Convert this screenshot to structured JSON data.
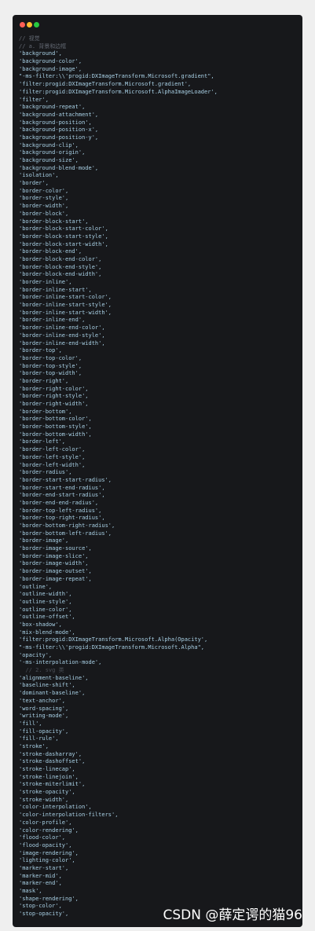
{
  "window": {
    "traffic_lights": [
      "close",
      "minimize",
      "maximize"
    ],
    "colors": {
      "background": "#17181b",
      "string": "#a9d1e6",
      "comment": "#636973"
    }
  },
  "code_lines": [
    {
      "text": "// 视觉",
      "type": "comment"
    },
    {
      "text": "// a. 背景和边框",
      "type": "comment"
    },
    {
      "text": "'background',",
      "type": "string"
    },
    {
      "text": "'background-color',",
      "type": "string"
    },
    {
      "text": "'background-image',",
      "type": "string"
    },
    {
      "text": "\"-ms-filter:\\\\'progid:DXImageTransform.Microsoft.gradient\",",
      "type": "string"
    },
    {
      "text": "'filter:progid:DXImageTransform.Microsoft.gradient',",
      "type": "string"
    },
    {
      "text": "'filter:progid:DXImageTransform.Microsoft.AlphaImageLoader',",
      "type": "string"
    },
    {
      "text": "'filter',",
      "type": "string"
    },
    {
      "text": "'background-repeat',",
      "type": "string"
    },
    {
      "text": "'background-attachment',",
      "type": "string"
    },
    {
      "text": "'background-position',",
      "type": "string"
    },
    {
      "text": "'background-position-x',",
      "type": "string"
    },
    {
      "text": "'background-position-y',",
      "type": "string"
    },
    {
      "text": "'background-clip',",
      "type": "string"
    },
    {
      "text": "'background-origin',",
      "type": "string"
    },
    {
      "text": "'background-size',",
      "type": "string"
    },
    {
      "text": "'background-blend-mode',",
      "type": "string"
    },
    {
      "text": "'isolation',",
      "type": "string"
    },
    {
      "text": "'border',",
      "type": "string"
    },
    {
      "text": "'border-color',",
      "type": "string"
    },
    {
      "text": "'border-style',",
      "type": "string"
    },
    {
      "text": "'border-width',",
      "type": "string"
    },
    {
      "text": "'border-block',",
      "type": "string"
    },
    {
      "text": "'border-block-start',",
      "type": "string"
    },
    {
      "text": "'border-block-start-color',",
      "type": "string"
    },
    {
      "text": "'border-block-start-style',",
      "type": "string"
    },
    {
      "text": "'border-block-start-width',",
      "type": "string"
    },
    {
      "text": "'border-block-end',",
      "type": "string"
    },
    {
      "text": "'border-block-end-color',",
      "type": "string"
    },
    {
      "text": "'border-block-end-style',",
      "type": "string"
    },
    {
      "text": "'border-block-end-width',",
      "type": "string"
    },
    {
      "text": "'border-inline',",
      "type": "string"
    },
    {
      "text": "'border-inline-start',",
      "type": "string"
    },
    {
      "text": "'border-inline-start-color',",
      "type": "string"
    },
    {
      "text": "'border-inline-start-style',",
      "type": "string"
    },
    {
      "text": "'border-inline-start-width',",
      "type": "string"
    },
    {
      "text": "'border-inline-end',",
      "type": "string"
    },
    {
      "text": "'border-inline-end-color',",
      "type": "string"
    },
    {
      "text": "'border-inline-end-style',",
      "type": "string"
    },
    {
      "text": "'border-inline-end-width',",
      "type": "string"
    },
    {
      "text": "'border-top',",
      "type": "string"
    },
    {
      "text": "'border-top-color',",
      "type": "string"
    },
    {
      "text": "'border-top-style',",
      "type": "string"
    },
    {
      "text": "'border-top-width',",
      "type": "string"
    },
    {
      "text": "'border-right',",
      "type": "string"
    },
    {
      "text": "'border-right-color',",
      "type": "string"
    },
    {
      "text": "'border-right-style',",
      "type": "string"
    },
    {
      "text": "'border-right-width',",
      "type": "string"
    },
    {
      "text": "'border-bottom',",
      "type": "string"
    },
    {
      "text": "'border-bottom-color',",
      "type": "string"
    },
    {
      "text": "'border-bottom-style',",
      "type": "string"
    },
    {
      "text": "'border-bottom-width',",
      "type": "string"
    },
    {
      "text": "'border-left',",
      "type": "string"
    },
    {
      "text": "'border-left-color',",
      "type": "string"
    },
    {
      "text": "'border-left-style',",
      "type": "string"
    },
    {
      "text": "'border-left-width',",
      "type": "string"
    },
    {
      "text": "'border-radius',",
      "type": "string"
    },
    {
      "text": "'border-start-start-radius',",
      "type": "string"
    },
    {
      "text": "'border-start-end-radius',",
      "type": "string"
    },
    {
      "text": "'border-end-start-radius',",
      "type": "string"
    },
    {
      "text": "'border-end-end-radius',",
      "type": "string"
    },
    {
      "text": "'border-top-left-radius',",
      "type": "string"
    },
    {
      "text": "'border-top-right-radius',",
      "type": "string"
    },
    {
      "text": "'border-bottom-right-radius',",
      "type": "string"
    },
    {
      "text": "'border-bottom-left-radius',",
      "type": "string"
    },
    {
      "text": "'border-image',",
      "type": "string"
    },
    {
      "text": "'border-image-source',",
      "type": "string"
    },
    {
      "text": "'border-image-slice',",
      "type": "string"
    },
    {
      "text": "'border-image-width',",
      "type": "string"
    },
    {
      "text": "'border-image-outset',",
      "type": "string"
    },
    {
      "text": "'border-image-repeat',",
      "type": "string"
    },
    {
      "text": "'outline',",
      "type": "string"
    },
    {
      "text": "'outline-width',",
      "type": "string"
    },
    {
      "text": "'outline-style',",
      "type": "string"
    },
    {
      "text": "'outline-color',",
      "type": "string"
    },
    {
      "text": "'outline-offset',",
      "type": "string"
    },
    {
      "text": "'box-shadow',",
      "type": "string"
    },
    {
      "text": "'mix-blend-mode',",
      "type": "string"
    },
    {
      "text": "'filter:progid:DXImageTransform.Microsoft.Alpha(Opacity',",
      "type": "string"
    },
    {
      "text": "\"-ms-filter:\\\\'progid:DXImageTransform.Microsoft.Alpha\",",
      "type": "string"
    },
    {
      "text": "'opacity',",
      "type": "string"
    },
    {
      "text": "'-ms-interpolation-mode',",
      "type": "string"
    },
    {
      "text": "  // 2. svg 类",
      "type": "comment-dim"
    },
    {
      "text": "'alignment-baseline',",
      "type": "string"
    },
    {
      "text": "'baseline-shift',",
      "type": "string"
    },
    {
      "text": "'dominant-baseline',",
      "type": "string"
    },
    {
      "text": "'text-anchor',",
      "type": "string"
    },
    {
      "text": "'word-spacing',",
      "type": "string"
    },
    {
      "text": "'writing-mode',",
      "type": "string"
    },
    {
      "text": "'fill',",
      "type": "string"
    },
    {
      "text": "'fill-opacity',",
      "type": "string"
    },
    {
      "text": "'fill-rule',",
      "type": "string"
    },
    {
      "text": "'stroke',",
      "type": "string"
    },
    {
      "text": "'stroke-dasharray',",
      "type": "string"
    },
    {
      "text": "'stroke-dashoffset',",
      "type": "string"
    },
    {
      "text": "'stroke-linecap',",
      "type": "string"
    },
    {
      "text": "'stroke-linejoin',",
      "type": "string"
    },
    {
      "text": "'stroke-miterlimit',",
      "type": "string"
    },
    {
      "text": "'stroke-opacity',",
      "type": "string"
    },
    {
      "text": "'stroke-width',",
      "type": "string"
    },
    {
      "text": "'color-interpolation',",
      "type": "string"
    },
    {
      "text": "'color-interpolation-filters',",
      "type": "string"
    },
    {
      "text": "'color-profile',",
      "type": "string"
    },
    {
      "text": "'color-rendering',",
      "type": "string"
    },
    {
      "text": "'flood-color',",
      "type": "string"
    },
    {
      "text": "'flood-opacity',",
      "type": "string"
    },
    {
      "text": "'image-rendering',",
      "type": "string"
    },
    {
      "text": "'lighting-color',",
      "type": "string"
    },
    {
      "text": "'marker-start',",
      "type": "string"
    },
    {
      "text": "'marker-mid',",
      "type": "string"
    },
    {
      "text": "'marker-end',",
      "type": "string"
    },
    {
      "text": "'mask',",
      "type": "string"
    },
    {
      "text": "'shape-rendering',",
      "type": "string"
    },
    {
      "text": "'stop-color',",
      "type": "string"
    },
    {
      "text": "'stop-opacity',",
      "type": "string"
    }
  ],
  "watermark": {
    "text": "CSDN @薛定谔的猫96"
  }
}
